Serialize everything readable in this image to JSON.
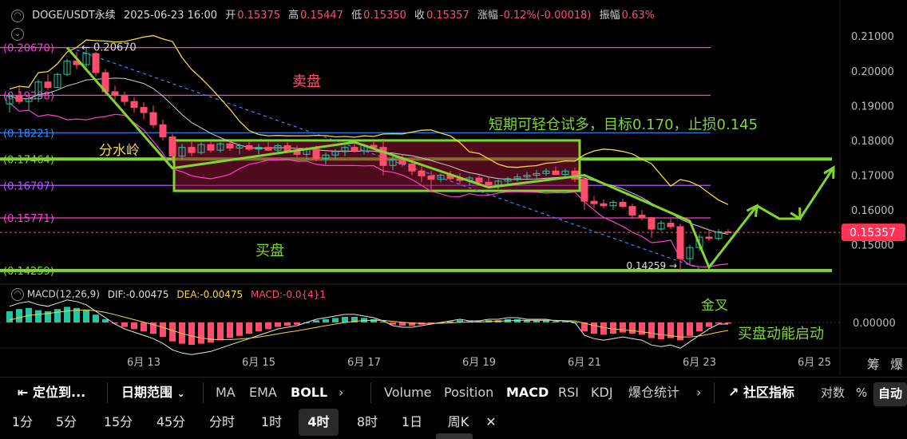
{
  "header": {
    "symbol": "DOGE/USDT永续",
    "datetime": "2025-06-23 16:00",
    "open_label": "开",
    "open": "0.15375",
    "high_label": "高",
    "high": "0.15447",
    "low_label": "低",
    "low": "0.15350",
    "close_label": "收",
    "close": "0.15357",
    "change_label": "涨幅",
    "change": "-0.12%(-0.00018)",
    "amp_label": "振幅",
    "amp": "0.63%"
  },
  "macd_header": {
    "name": "MACD(12,26,9)",
    "dif": "DIF:-0.00475",
    "dea": "DEA:-0.00475",
    "macd": "MACD:-0.0{4}1"
  },
  "colors": {
    "up": "#26c6a2",
    "down": "#ff4d6d",
    "green_line": "#7fd62e",
    "yellow": "#f5d742",
    "magenta": "#ff3bd3",
    "blue": "#2f8cff",
    "purple": "#b05cff"
  },
  "chart_data": {
    "type": "candlestick",
    "instrument": "DOGE/USDT永续",
    "interval": "4时",
    "x_tick_labels": [
      "6月 13",
      "6月 15",
      "6月 17",
      "6月 19",
      "6月 21",
      "6月 23",
      "6月 25"
    ],
    "y_tick_labels": [
      "0.21000",
      "0.20000",
      "0.19000",
      "0.18000",
      "0.17000",
      "0.16000",
      "0.15000"
    ],
    "ylim": [
      0.1405,
      0.2135
    ],
    "last_price": "0.15357",
    "ohlc": [
      [
        0.1905,
        0.1935,
        0.188,
        0.1928
      ],
      [
        0.1928,
        0.1955,
        0.1905,
        0.1912
      ],
      [
        0.1912,
        0.1925,
        0.1885,
        0.192
      ],
      [
        0.192,
        0.1975,
        0.191,
        0.1968
      ],
      [
        0.1968,
        0.199,
        0.1945,
        0.1952
      ],
      [
        0.1952,
        0.1995,
        0.195,
        0.199
      ],
      [
        0.199,
        0.2035,
        0.1985,
        0.2028
      ],
      [
        0.2028,
        0.2055,
        0.2005,
        0.2018
      ],
      [
        0.2018,
        0.2067,
        0.201,
        0.205
      ],
      [
        0.205,
        0.2055,
        0.1985,
        0.1995
      ],
      [
        0.1995,
        0.2005,
        0.193,
        0.194
      ],
      [
        0.194,
        0.1958,
        0.1915,
        0.193
      ],
      [
        0.193,
        0.194,
        0.19,
        0.1912
      ],
      [
        0.1912,
        0.1925,
        0.188,
        0.1895
      ],
      [
        0.1895,
        0.191,
        0.186,
        0.188
      ],
      [
        0.188,
        0.19,
        0.1835,
        0.1845
      ],
      [
        0.1845,
        0.186,
        0.18,
        0.181
      ],
      [
        0.181,
        0.182,
        0.1735,
        0.1755
      ],
      [
        0.1755,
        0.179,
        0.1745,
        0.178
      ],
      [
        0.178,
        0.18,
        0.1755,
        0.1765
      ],
      [
        0.1765,
        0.1795,
        0.176,
        0.1788
      ],
      [
        0.1788,
        0.18,
        0.1765,
        0.1772
      ],
      [
        0.1772,
        0.1795,
        0.1765,
        0.179
      ],
      [
        0.179,
        0.18,
        0.177,
        0.1778
      ],
      [
        0.1778,
        0.179,
        0.176,
        0.1785
      ],
      [
        0.1785,
        0.1798,
        0.177,
        0.1775
      ],
      [
        0.1775,
        0.179,
        0.176,
        0.178
      ],
      [
        0.178,
        0.1795,
        0.177,
        0.1772
      ],
      [
        0.1772,
        0.179,
        0.176,
        0.1785
      ],
      [
        0.1785,
        0.1795,
        0.1765,
        0.177
      ],
      [
        0.177,
        0.1785,
        0.175,
        0.176
      ],
      [
        0.176,
        0.178,
        0.1745,
        0.1775
      ],
      [
        0.1775,
        0.1785,
        0.174,
        0.1748
      ],
      [
        0.1748,
        0.1765,
        0.173,
        0.1758
      ],
      [
        0.1758,
        0.1775,
        0.1745,
        0.1768
      ],
      [
        0.1768,
        0.1785,
        0.1755,
        0.178
      ],
      [
        0.178,
        0.1795,
        0.1765,
        0.177
      ],
      [
        0.177,
        0.179,
        0.176,
        0.1786
      ],
      [
        0.1786,
        0.18,
        0.1775,
        0.178
      ],
      [
        0.178,
        0.1805,
        0.17,
        0.1728
      ],
      [
        0.1728,
        0.1755,
        0.1715,
        0.1745
      ],
      [
        0.1745,
        0.176,
        0.1725,
        0.1732
      ],
      [
        0.1732,
        0.1748,
        0.17,
        0.1712
      ],
      [
        0.1712,
        0.1725,
        0.168,
        0.1698
      ],
      [
        0.1698,
        0.1712,
        0.165,
        0.1688
      ],
      [
        0.1688,
        0.1705,
        0.168,
        0.17
      ],
      [
        0.17,
        0.1712,
        0.1685,
        0.169
      ],
      [
        0.169,
        0.1705,
        0.1675,
        0.1685
      ],
      [
        0.1685,
        0.1698,
        0.167,
        0.1692
      ],
      [
        0.1692,
        0.17,
        0.167,
        0.168
      ],
      [
        0.168,
        0.1695,
        0.1665,
        0.1672
      ],
      [
        0.1672,
        0.1688,
        0.166,
        0.1683
      ],
      [
        0.1683,
        0.1695,
        0.1672,
        0.169
      ],
      [
        0.169,
        0.1705,
        0.1682,
        0.1695
      ],
      [
        0.1695,
        0.171,
        0.1685,
        0.17
      ],
      [
        0.17,
        0.1715,
        0.169,
        0.1705
      ],
      [
        0.1705,
        0.172,
        0.1698,
        0.1712
      ],
      [
        0.1712,
        0.1725,
        0.17,
        0.1702
      ],
      [
        0.1702,
        0.1718,
        0.1695,
        0.1712
      ],
      [
        0.1712,
        0.1722,
        0.168,
        0.1688
      ],
      [
        0.1688,
        0.1695,
        0.16,
        0.1625
      ],
      [
        0.1625,
        0.164,
        0.1605,
        0.1618
      ],
      [
        0.1618,
        0.163,
        0.1605,
        0.1612
      ],
      [
        0.1612,
        0.1628,
        0.16,
        0.1622
      ],
      [
        0.1622,
        0.1632,
        0.1605,
        0.161
      ],
      [
        0.161,
        0.1618,
        0.1575,
        0.1585
      ],
      [
        0.1585,
        0.16,
        0.157,
        0.1578
      ],
      [
        0.1578,
        0.158,
        0.152,
        0.1545
      ],
      [
        0.1545,
        0.157,
        0.154,
        0.1562
      ],
      [
        0.1562,
        0.1575,
        0.1545,
        0.1552
      ],
      [
        0.1552,
        0.156,
        0.1426,
        0.146
      ],
      [
        0.146,
        0.15,
        0.144,
        0.1492
      ],
      [
        0.1492,
        0.153,
        0.1482,
        0.1522
      ],
      [
        0.1522,
        0.1545,
        0.151,
        0.1518
      ],
      [
        0.1518,
        0.1545,
        0.1512,
        0.1537
      ],
      [
        0.1537,
        0.1545,
        0.1535,
        0.1536
      ]
    ],
    "levels": [
      {
        "label": "(0.20670)",
        "value": 0.2067,
        "color": "#ff3bd3"
      },
      {
        "label": "(0.19298)",
        "value": 0.19298,
        "color": "#ff3bd3"
      },
      {
        "label": "(0.18221)",
        "value": 0.18221,
        "color": "#2f8cff"
      },
      {
        "label": "(0.17464)",
        "value": 0.17464,
        "color": "#7fd62e"
      },
      {
        "label": "(0.16707)",
        "value": 0.16707,
        "color": "#b05cff"
      },
      {
        "label": "(0.15771)",
        "value": 0.15771,
        "color": "#ff3bd3"
      },
      {
        "label": "(0.14259)",
        "value": 0.14259,
        "color": "#7fd62e"
      }
    ],
    "high_marker": "0.20670",
    "low_marker": "0.14259",
    "annotations": {
      "sell": "卖盘",
      "buy": "买盘",
      "watershed": "分水岭",
      "plan": "短期可轻仓试多，目标0.170，止损0.145",
      "golden_cross": "金叉",
      "buy_momentum": "买盘动能启动"
    },
    "box": {
      "top": 0.18,
      "bottom": 0.1655
    },
    "macd": {
      "histogram": [
        0.001,
        0.0012,
        0.0013,
        0.0011,
        0.001,
        0.0012,
        0.0014,
        0.0013,
        0.0011,
        0.0007,
        0.0003,
        -0.0001,
        -0.0004,
        -0.0006,
        -0.0008,
        -0.001,
        -0.0013,
        -0.0017,
        -0.0019,
        -0.002,
        -0.0019,
        -0.0018,
        -0.0016,
        -0.0014,
        -0.0012,
        -0.001,
        -0.0008,
        -0.0006,
        -0.0004,
        -0.0003,
        -0.0002,
        0.0,
        0.0002,
        0.0003,
        0.0004,
        0.0005,
        0.0005,
        0.0004,
        0.0003,
        0.0001,
        -0.0002,
        -0.0003,
        -0.0003,
        -0.0002,
        -0.0001,
        0.0,
        0.0001,
        0.0002,
        0.0001,
        0.0001,
        0.0002,
        0.0002,
        0.0003,
        0.0003,
        0.0002,
        0.0002,
        0.0002,
        0.0001,
        0.0001,
        0.0,
        -0.0008,
        -0.001,
        -0.0011,
        -0.001,
        -0.0009,
        -0.001,
        -0.0011,
        -0.0014,
        -0.0015,
        -0.0014,
        -0.0016,
        -0.0012,
        -0.0008,
        -0.0004,
        -0.0001,
        -0.0001
      ]
    }
  },
  "toolbar": {
    "locate": "定位到...",
    "date_range": "日期范围",
    "indicators_main": [
      "MA",
      "EMA",
      "BOLL"
    ],
    "indicators_sub": [
      "Volume",
      "Position",
      "MACD",
      "RSI",
      "KDJ",
      "爆仓统计"
    ],
    "community": "社区指标",
    "log": "对数",
    "percent": "%",
    "auto": "自动",
    "more": "›"
  },
  "timeframes": [
    "1分",
    "5分",
    "15分",
    "45分",
    "分时",
    "1时",
    "4时",
    "8时",
    "1日",
    "周K"
  ],
  "selected_timeframe": "4时",
  "close_tf": "✕",
  "side_labels": {
    "a": "筹",
    "b": "爆"
  }
}
